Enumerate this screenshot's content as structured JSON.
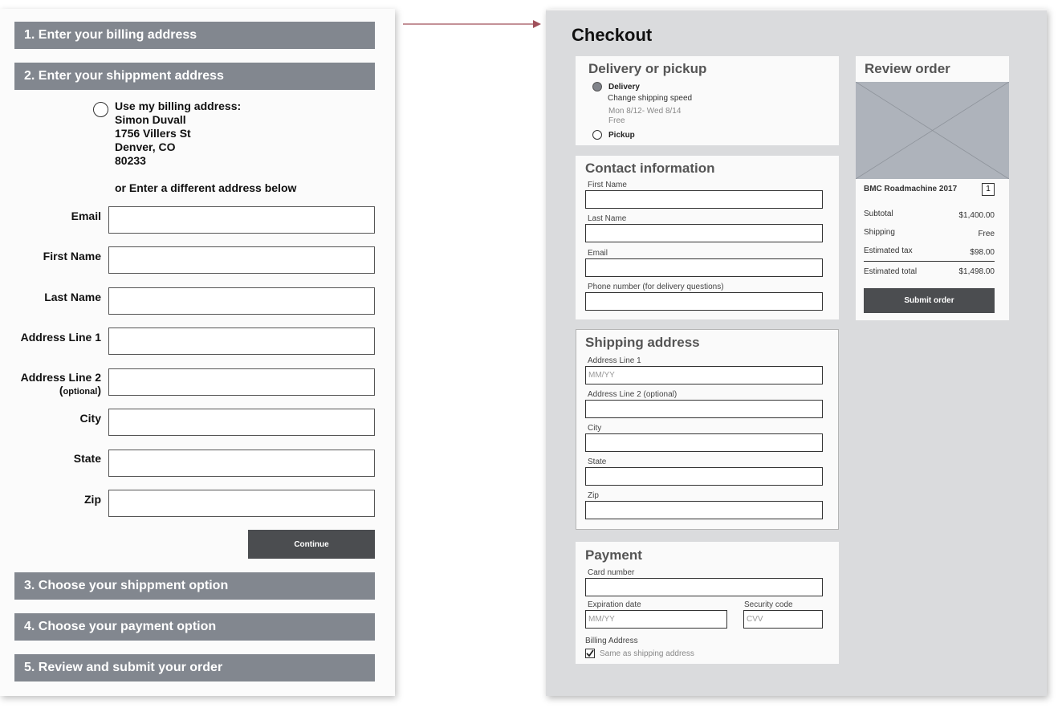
{
  "left_flow": {
    "steps": {
      "s1": "1. Enter your billing address",
      "s2": "2. Enter your shippment address",
      "s3": "3. Choose your shippment option",
      "s4": "4. Choose your payment option",
      "s5": "5. Review and submit your order"
    },
    "billing": {
      "heading": "Use my billing address:",
      "name": "Simon Duvall",
      "street": "1756 Villers St",
      "city_state": "Denver, CO",
      "zip": "80233"
    },
    "alt_address": "or Enter a different address below",
    "fields": {
      "email": "Email",
      "first_name": "First Name",
      "last_name": "Last Name",
      "address1": "Address Line 1",
      "address2": "Address Line 2",
      "address2_note": "optional",
      "city": "City",
      "state": "State",
      "zip": "Zip"
    },
    "continue_label": "Continue"
  },
  "checkout": {
    "title": "Checkout",
    "delivery": {
      "title": "Delivery or pickup",
      "option_delivery": "Delivery",
      "change_speed": "Change shipping speed",
      "dates": "Mon 8/12- Wed 8/14",
      "cost": "Free",
      "option_pickup": "Pickup",
      "selected": "Delivery"
    },
    "contact": {
      "title": "Contact information",
      "first_name": "First Name",
      "last_name": "Last Name",
      "email": "Email",
      "phone": "Phone number (for delivery questions)"
    },
    "shipping": {
      "title": "Shipping address",
      "address1": "Address Line 1",
      "address1_placeholder": "MM/YY",
      "address2": "Address Line 2 (optional)",
      "city": "City",
      "state": "State",
      "zip": "Zip"
    },
    "payment": {
      "title": "Payment",
      "card_number": "Card number",
      "expiration": "Expiration date",
      "expiration_placeholder": "MM/YY",
      "security": "Security code",
      "security_placeholder": "CVV",
      "billing_address": "Billing Address",
      "same_as_shipping": "Same as shipping address",
      "same_checked": true
    },
    "review": {
      "title": "Review order",
      "product_name": "BMC Roadmachine 2017",
      "quantity": "1",
      "subtotal_label": "Subtotal",
      "subtotal_value": "$1,400.00",
      "shipping_label": "Shipping",
      "shipping_value": "Free",
      "tax_label": "Estimated tax",
      "tax_value": "$98.00",
      "total_label": "Estimated total",
      "total_value": "$1,498.00",
      "submit_label": "Submit order"
    }
  },
  "colors": {
    "step_bar": "#82878f",
    "button_dark": "#4b4d50",
    "arrow": "#a0505a",
    "checkout_bg": "#dadbdd",
    "image_placeholder": "#aeb3bb"
  }
}
